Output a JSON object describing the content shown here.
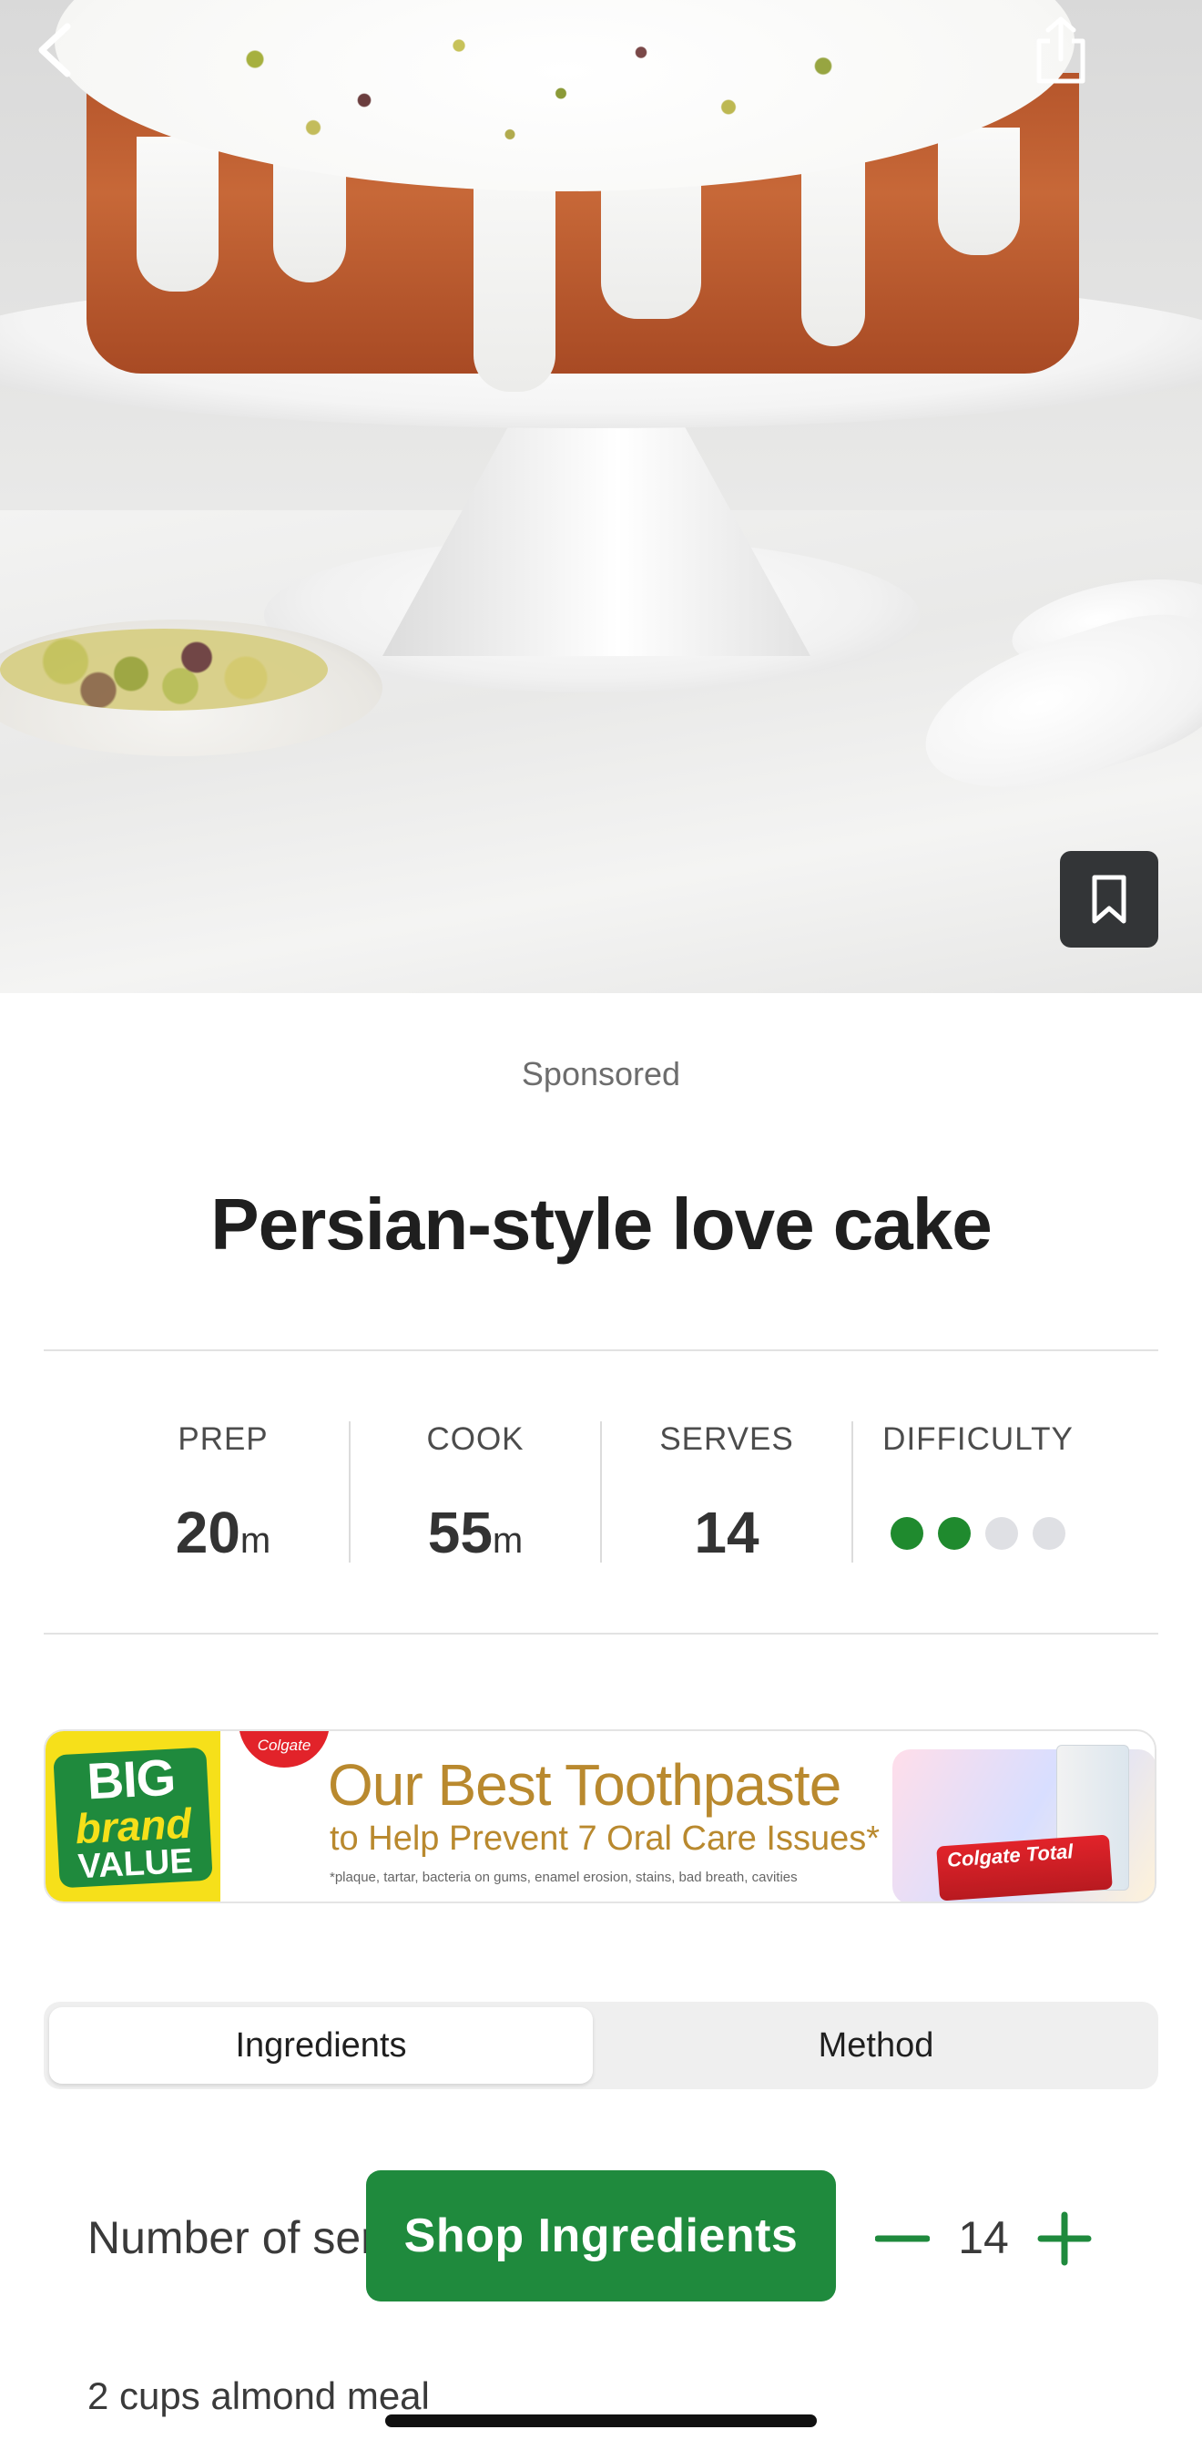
{
  "hero": {
    "image_alt": "Persian-style love cake on white cake stand with pistachios",
    "back_icon": "chevron-left-icon",
    "share_icon": "share-icon",
    "bookmark_icon": "bookmark-icon"
  },
  "sponsored_label": "Sponsored",
  "recipe": {
    "title": "Persian-style love cake",
    "stats": {
      "prep": {
        "label": "PREP",
        "value": "20",
        "unit": "m"
      },
      "cook": {
        "label": "COOK",
        "value": "55",
        "unit": "m"
      },
      "serves": {
        "label": "SERVES",
        "value": "14"
      },
      "difficulty": {
        "label": "DIFFICULTY",
        "level": 2,
        "max": 4
      }
    }
  },
  "ad": {
    "badge_line1": "BIG",
    "badge_line2": "brand",
    "badge_line3": "VALUE",
    "brand_logo": "Colgate",
    "headline": "Our Best Toothpaste",
    "subline": "to Help Prevent 7 Oral Care Issues*",
    "fine_print": "*plaque, tartar, bacteria on gums, enamel erosion, stains, bad breath, cavities",
    "product_label": "Colgate Total"
  },
  "tabs": [
    {
      "label": "Ingredients",
      "active": true
    },
    {
      "label": "Method",
      "active": false
    }
  ],
  "servings": {
    "label": "Number of servings",
    "count": "14"
  },
  "shop_button_label": "Shop Ingredients",
  "ingredients": [
    "2 cups almond meal"
  ],
  "colors": {
    "accent_green": "#1f8a3d",
    "difficulty_on": "#1f8a2e",
    "difficulty_off": "#dfe0e4"
  }
}
